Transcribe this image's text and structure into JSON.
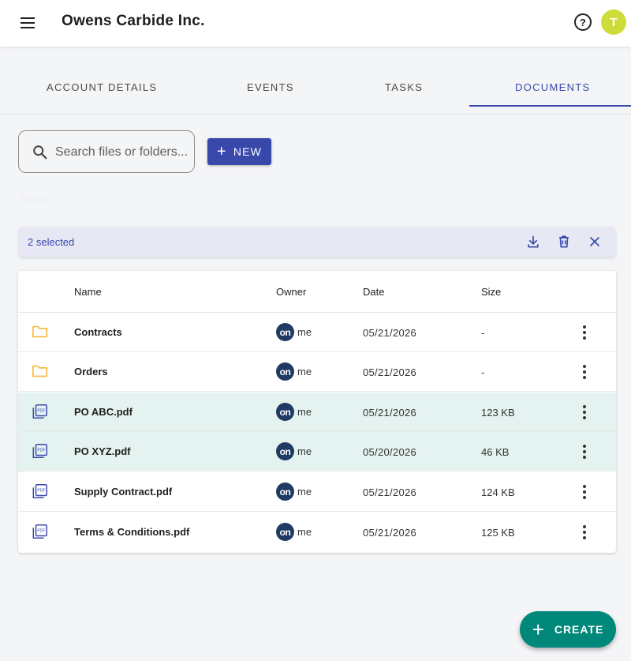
{
  "header": {
    "title": "Owens Carbide Inc.",
    "help_label": "?",
    "avatar_initial": "T",
    "avatar_color": "#cddc39"
  },
  "tabs": [
    {
      "label": "ACCOUNT DETAILS",
      "active": false
    },
    {
      "label": "EVENTS",
      "active": false
    },
    {
      "label": "TASKS",
      "active": false
    },
    {
      "label": "DOCUMENTS",
      "active": true
    }
  ],
  "toolbar": {
    "search_placeholder": "Search files or folders...",
    "new_label": "NEW",
    "ghost_label": "Name"
  },
  "selection_bar": {
    "text": "2 selected",
    "icons": [
      "download-icon",
      "delete-icon",
      "close-icon"
    ]
  },
  "table": {
    "columns": [
      "Name",
      "Owner",
      "Date",
      "Size"
    ],
    "rows": [
      {
        "type": "folder",
        "name": "Contracts",
        "owner_badge": "on",
        "owner": "me",
        "date": "05/21/2026",
        "size": "-",
        "selected": false
      },
      {
        "type": "folder",
        "name": "Orders",
        "owner_badge": "on",
        "owner": "me",
        "date": "05/21/2026",
        "size": "-",
        "selected": false
      },
      {
        "type": "pdf",
        "name": "PO ABC.pdf",
        "owner_badge": "on",
        "owner": "me",
        "date": "05/21/2026",
        "size": "123 KB",
        "selected": true
      },
      {
        "type": "pdf",
        "name": "PO XYZ.pdf",
        "owner_badge": "on",
        "owner": "me",
        "date": "05/20/2026",
        "size": "46 KB",
        "selected": true
      },
      {
        "type": "pdf",
        "name": "Supply Contract.pdf",
        "owner_badge": "on",
        "owner": "me",
        "date": "05/21/2026",
        "size": "124 KB",
        "selected": false
      },
      {
        "type": "pdf",
        "name": "Terms & Conditions.pdf",
        "owner_badge": "on",
        "owner": "me",
        "date": "05/21/2026",
        "size": "125 KB",
        "selected": false
      }
    ]
  },
  "fab": {
    "label": "CREATE"
  },
  "colors": {
    "primary": "#3949ab",
    "accent": "#00897b",
    "selected_row": "#e4f2f0",
    "folder": "#f5b942"
  }
}
